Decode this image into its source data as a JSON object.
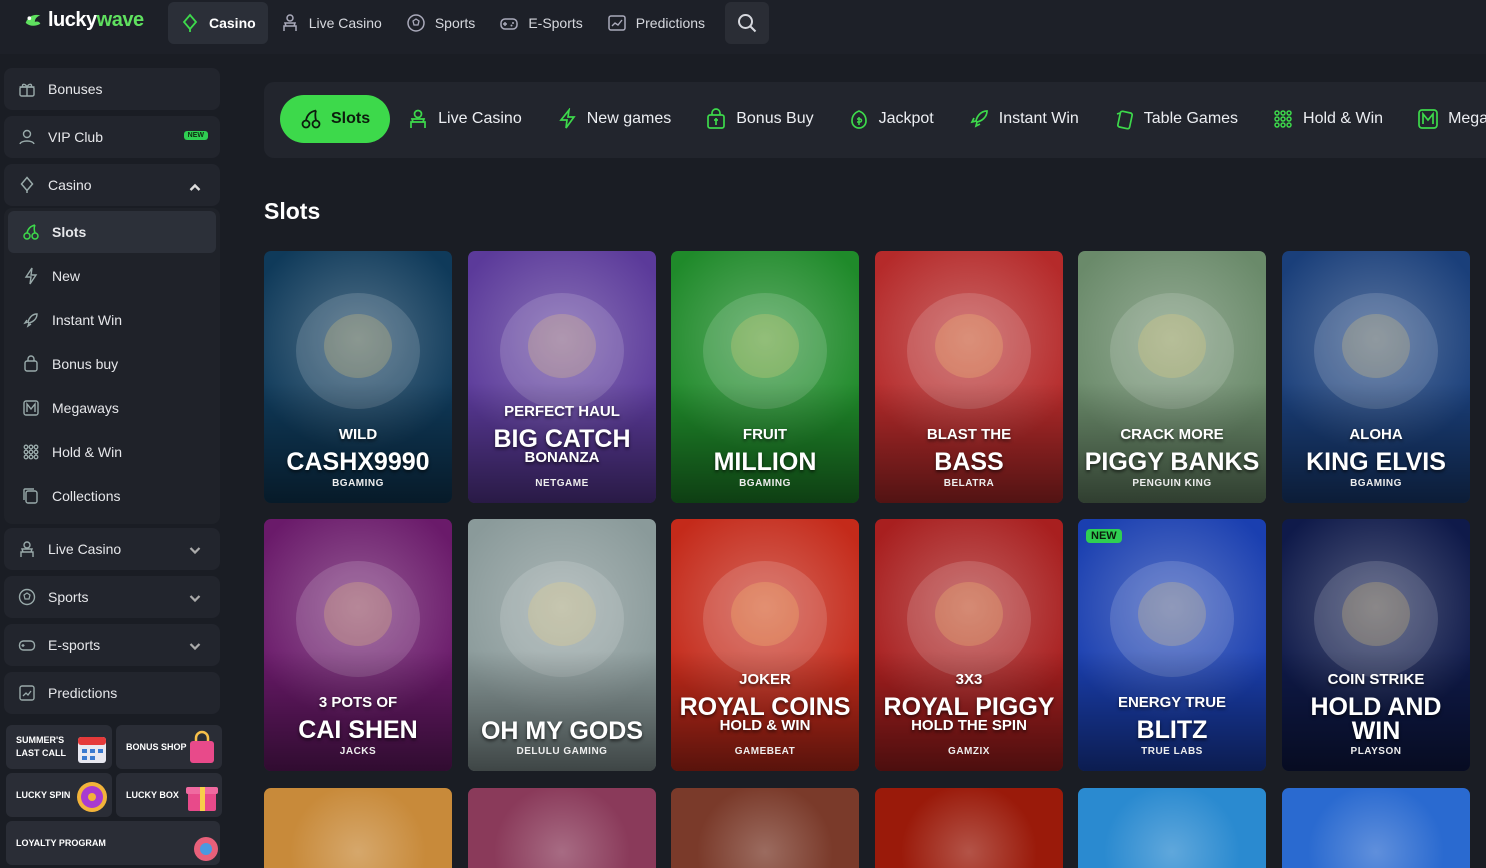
{
  "brand": {
    "lucky": "lucky",
    "wave": "wave"
  },
  "topnav": [
    {
      "label": "Casino",
      "icon": "casino-icon",
      "active": true
    },
    {
      "label": "Live Casino",
      "icon": "dealer-icon"
    },
    {
      "label": "Sports",
      "icon": "ball-icon"
    },
    {
      "label": "E-Sports",
      "icon": "gamepad-icon"
    },
    {
      "label": "Predictions",
      "icon": "chart-icon"
    }
  ],
  "sidebar": {
    "bonuses": "Bonuses",
    "vip": "VIP Club",
    "vip_badge": "NEW",
    "casino": "Casino",
    "casino_sub": [
      {
        "label": "Slots",
        "icon": "cherries-icon"
      },
      {
        "label": "New",
        "icon": "bolt-icon"
      },
      {
        "label": "Instant Win",
        "icon": "rocket-icon"
      },
      {
        "label": "Bonus buy",
        "icon": "bag-icon"
      },
      {
        "label": "Megaways",
        "icon": "megaways-icon"
      },
      {
        "label": "Hold & Win",
        "icon": "dots-icon"
      },
      {
        "label": "Collections",
        "icon": "collections-icon"
      }
    ],
    "live_casino": "Live Casino",
    "sports": "Sports",
    "esports": "E-sports",
    "predictions": "Predictions",
    "promos": {
      "summer_1": "SUMMER'S",
      "summer_2": "LAST CALL",
      "bonus_shop": "BONUS SHOP",
      "lucky_spin": "LUCKY SPIN",
      "lucky_box": "LUCKY BOX",
      "loyalty": "LOYALTY PROGRAM"
    }
  },
  "categories": [
    {
      "label": "Slots",
      "active": true
    },
    {
      "label": "Live Casino"
    },
    {
      "label": "New games"
    },
    {
      "label": "Bonus Buy"
    },
    {
      "label": "Jackpot"
    },
    {
      "label": "Instant Win"
    },
    {
      "label": "Table Games"
    },
    {
      "label": "Hold & Win"
    },
    {
      "label": "Mega"
    }
  ],
  "section_title": "Slots",
  "games_row1": [
    {
      "line1": "WILD",
      "line2": "CASHX9990",
      "provider": "BGAMING",
      "bg": "#0f3a5a"
    },
    {
      "line1": "PERFECT HAUL",
      "line2": "BIG CATCH",
      "line3": "BONANZA",
      "provider": "NETGAME",
      "bg": "#5b3a9a"
    },
    {
      "line1": "FRUIT",
      "line2": "MILLION",
      "provider": "BGAMING",
      "bg": "#1f8a2a"
    },
    {
      "line1": "BLAST THE",
      "line2": "BASS",
      "provider": "BELATRA",
      "bg": "#b52a2a"
    },
    {
      "line1": "CRACK MORE",
      "line2": "PIGGY BANKS",
      "provider": "PENGUIN KING",
      "bg": "#6a8a6a"
    },
    {
      "line1": "ALOHA",
      "line2": "KING ELVIS",
      "provider": "BGAMING",
      "bg": "#1a3f7a"
    }
  ],
  "games_row2": [
    {
      "line1": "3 POTS OF",
      "line2": "CAI SHEN",
      "provider": "JACKS",
      "bg": "#6a1a6a"
    },
    {
      "line1": "OH MY GODS",
      "provider": "DELULU GAMING",
      "bg": "#8a9a9a"
    },
    {
      "line1": "JOKER",
      "line2": "ROYAL COINS",
      "line3": "HOLD & WIN",
      "provider": "GAMEBEAT",
      "bg": "#c42a1a"
    },
    {
      "line1": "3X3",
      "line2": "ROYAL PIGGY",
      "line3": "HOLD THE SPIN",
      "provider": "GAMZIX",
      "bg": "#a81f1f"
    },
    {
      "line1": "ENERGY TRUE",
      "line2": "BLITZ",
      "provider": "TRUE LABS",
      "bg": "#1a3fb0",
      "tag": "NEW"
    },
    {
      "line1": "COIN STRIKE",
      "line2": "HOLD AND",
      "line3": "WIN",
      "provider": "PLAYSON",
      "bg": "#0f1a4a"
    }
  ],
  "games_row3_colors": [
    "#c88a3a",
    "#8a3a5a",
    "#7a3a2a",
    "#9a1a0a",
    "#2a8ad0",
    "#2a6ad0"
  ]
}
